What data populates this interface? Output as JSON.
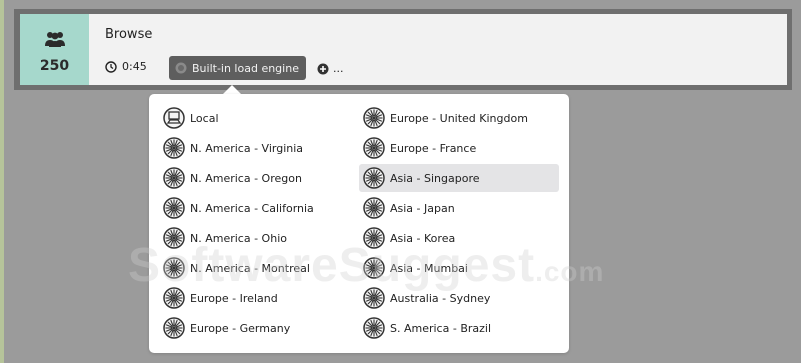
{
  "scenario": {
    "users": "250",
    "title": "Browse",
    "duration": "0:45",
    "engine_label": "Built-in load engine",
    "add_label": "..."
  },
  "menu": {
    "left": [
      {
        "label": "Local",
        "icon": "local-machine-icon"
      },
      {
        "label": "N. America - Virginia",
        "icon": "region-icon"
      },
      {
        "label": "N. America - Oregon",
        "icon": "region-icon"
      },
      {
        "label": "N. America - California",
        "icon": "region-icon"
      },
      {
        "label": "N. America - Ohio",
        "icon": "region-icon"
      },
      {
        "label": "N. America - Montreal",
        "icon": "region-icon"
      },
      {
        "label": "Europe - Ireland",
        "icon": "region-icon"
      },
      {
        "label": "Europe - Germany",
        "icon": "region-icon"
      }
    ],
    "right": [
      {
        "label": "Europe - United Kingdom",
        "icon": "region-icon"
      },
      {
        "label": "Europe - France",
        "icon": "region-icon"
      },
      {
        "label": "Asia - Singapore",
        "icon": "region-icon",
        "selected": true
      },
      {
        "label": "Asia - Japan",
        "icon": "region-icon"
      },
      {
        "label": "Asia - Korea",
        "icon": "region-icon"
      },
      {
        "label": "Asia - Mumbai",
        "icon": "region-icon"
      },
      {
        "label": "Australia - Sydney",
        "icon": "region-icon"
      },
      {
        "label": "S. America - Brazil",
        "icon": "region-icon"
      }
    ]
  },
  "watermark": {
    "main": "SoftwareSuggest",
    "suffix": ".com"
  },
  "colors": {
    "background": "#9b9b9b",
    "users_tile": "#a6d8cc",
    "engine_button": "#5e5e5e",
    "selected_item": "#e4e4e6"
  }
}
